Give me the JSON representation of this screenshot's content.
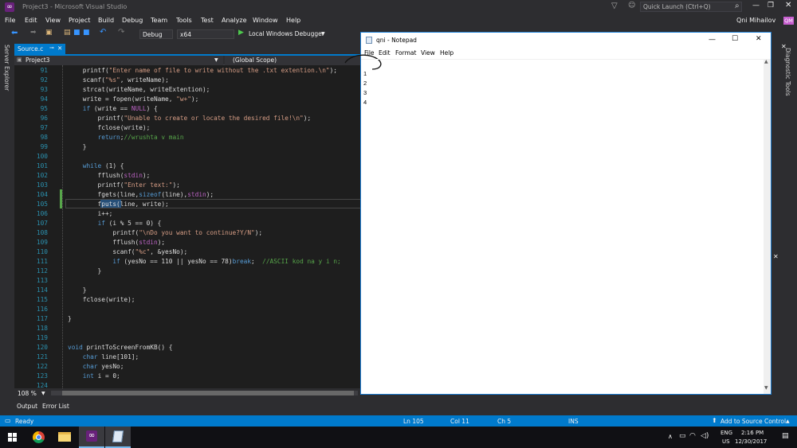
{
  "vs": {
    "title": "Project3 - Microsoft Visual Studio",
    "quick_launch_placeholder": "Quick Launch (Ctrl+Q)",
    "user_name": "Qni Mihailov",
    "user_initials": "QM",
    "menu": [
      "File",
      "Edit",
      "View",
      "Project",
      "Build",
      "Debug",
      "Team",
      "Tools",
      "Test",
      "Analyze",
      "Window",
      "Help"
    ],
    "config": "Debug",
    "platform": "x64",
    "run_label": "Local Windows Debugger",
    "doc_tab": "Source.c",
    "nav_project": "Project3",
    "nav_scope": "(Global Scope)",
    "left_panel": "Server Explorer",
    "right_panel": "Diagnostic Tools",
    "zoom": "108 %",
    "output_tabs": [
      "Output",
      "Error List"
    ],
    "status": {
      "ready": "Ready",
      "ln": "Ln 105",
      "col": "Col 11",
      "ch": "Ch 5",
      "mode": "INS",
      "source_control": "Add to Source Control"
    }
  },
  "code_lines": [
    {
      "n": "91",
      "t": [
        [
          "    printf(",
          ""
        ],
        [
          "\"Enter name of file to write without the .txt extention.\\n\"",
          "st"
        ],
        [
          ");",
          ""
        ]
      ]
    },
    {
      "n": "92",
      "t": [
        [
          "    scanf(",
          ""
        ],
        [
          "\"%s\"",
          "st"
        ],
        [
          ", writeName);",
          ""
        ]
      ]
    },
    {
      "n": "93",
      "t": [
        [
          "    strcat(writeName, writeExtention);",
          ""
        ]
      ]
    },
    {
      "n": "94",
      "t": [
        [
          "    write = fopen(writeName, ",
          ""
        ],
        [
          "\"w+\"",
          "st"
        ],
        [
          ");",
          ""
        ]
      ]
    },
    {
      "n": "95",
      "t": [
        [
          "    ",
          ""
        ],
        [
          "if",
          "kw"
        ],
        [
          " (write == ",
          ""
        ],
        [
          "NULL",
          "mc"
        ],
        [
          ") {",
          ""
        ]
      ]
    },
    {
      "n": "96",
      "t": [
        [
          "        printf(",
          ""
        ],
        [
          "\"Unable to create or locate the desired file!\\n\"",
          "st"
        ],
        [
          ");",
          ""
        ]
      ]
    },
    {
      "n": "97",
      "t": [
        [
          "        fclose(write);",
          ""
        ]
      ]
    },
    {
      "n": "98",
      "t": [
        [
          "        ",
          ""
        ],
        [
          "return",
          "kw"
        ],
        [
          ";",
          ""
        ],
        [
          "//wrushta v main",
          "cm"
        ]
      ]
    },
    {
      "n": "99",
      "t": [
        [
          "    }",
          ""
        ]
      ]
    },
    {
      "n": "100",
      "t": []
    },
    {
      "n": "101",
      "t": [
        [
          "    ",
          ""
        ],
        [
          "while",
          "kw"
        ],
        [
          " (1) {",
          ""
        ]
      ]
    },
    {
      "n": "102",
      "t": [
        [
          "        fflush(",
          ""
        ],
        [
          "stdin",
          "mc"
        ],
        [
          ");",
          ""
        ]
      ]
    },
    {
      "n": "103",
      "t": [
        [
          "        printf(",
          ""
        ],
        [
          "\"Enter text:\"",
          "st"
        ],
        [
          ");",
          ""
        ]
      ]
    },
    {
      "n": "104",
      "t": [
        [
          "        fgets(line,",
          ""
        ],
        [
          "sizeof",
          "kw"
        ],
        [
          "(line),",
          ""
        ],
        [
          "stdin",
          "mc"
        ],
        [
          ");",
          ""
        ]
      ]
    },
    {
      "n": "105",
      "t": [
        [
          "        fputs(line, write);",
          ""
        ]
      ]
    },
    {
      "n": "106",
      "t": [
        [
          "        i++;",
          ""
        ]
      ]
    },
    {
      "n": "107",
      "t": [
        [
          "        ",
          ""
        ],
        [
          "if",
          "kw"
        ],
        [
          " (i % 5 == 0) {",
          ""
        ]
      ]
    },
    {
      "n": "108",
      "t": [
        [
          "            printf(",
          ""
        ],
        [
          "\"\\nDo you want to continue?Y/N\"",
          "st"
        ],
        [
          ");",
          ""
        ]
      ]
    },
    {
      "n": "109",
      "t": [
        [
          "            fflush(",
          ""
        ],
        [
          "stdin",
          "mc"
        ],
        [
          ");",
          ""
        ]
      ]
    },
    {
      "n": "110",
      "t": [
        [
          "            scanf(",
          ""
        ],
        [
          "\"%c\"",
          "st"
        ],
        [
          ", &yesNo);",
          ""
        ]
      ]
    },
    {
      "n": "111",
      "t": [
        [
          "            ",
          ""
        ],
        [
          "if",
          "kw"
        ],
        [
          " (yesNo == 110 || yesNo == 78)",
          ""
        ],
        [
          "break",
          "kw"
        ],
        [
          ";  ",
          ""
        ],
        [
          "//ASCII kod na y i n;",
          "cm"
        ]
      ]
    },
    {
      "n": "112",
      "t": [
        [
          "        }",
          ""
        ]
      ]
    },
    {
      "n": "113",
      "t": []
    },
    {
      "n": "114",
      "t": [
        [
          "    }",
          ""
        ]
      ]
    },
    {
      "n": "115",
      "t": [
        [
          "    fclose(write);",
          ""
        ]
      ]
    },
    {
      "n": "116",
      "t": []
    },
    {
      "n": "117",
      "t": [
        [
          "}",
          ""
        ]
      ]
    },
    {
      "n": "118",
      "t": []
    },
    {
      "n": "119",
      "t": []
    },
    {
      "n": "120",
      "t": [
        [
          "void",
          "kw"
        ],
        [
          " printToScreenFromKB() {",
          ""
        ]
      ]
    },
    {
      "n": "121",
      "t": [
        [
          "    ",
          ""
        ],
        [
          "char",
          "kw"
        ],
        [
          " line[101];",
          ""
        ]
      ]
    },
    {
      "n": "122",
      "t": [
        [
          "    ",
          ""
        ],
        [
          "char",
          "kw"
        ],
        [
          " yesNo;",
          ""
        ]
      ]
    },
    {
      "n": "123",
      "t": [
        [
          "    ",
          ""
        ],
        [
          "int",
          "kw"
        ],
        [
          " i = 0;",
          ""
        ]
      ]
    },
    {
      "n": "124",
      "t": []
    }
  ],
  "notepad": {
    "title": "qni - Notepad",
    "menu": [
      "File",
      "Edit",
      "Format",
      "View",
      "Help"
    ],
    "lines": [
      "1",
      "2",
      "3",
      "4"
    ]
  },
  "taskbar": {
    "lang": "ENG",
    "region": "US",
    "time": "2:16 PM",
    "date": "12/30/2017"
  },
  "colors": {
    "accent": "#007acc",
    "vs_bg": "#2d2d30",
    "editor_bg": "#1e1e1e",
    "vs_purple": "#68217a",
    "user_badge": "#c75fcf"
  }
}
